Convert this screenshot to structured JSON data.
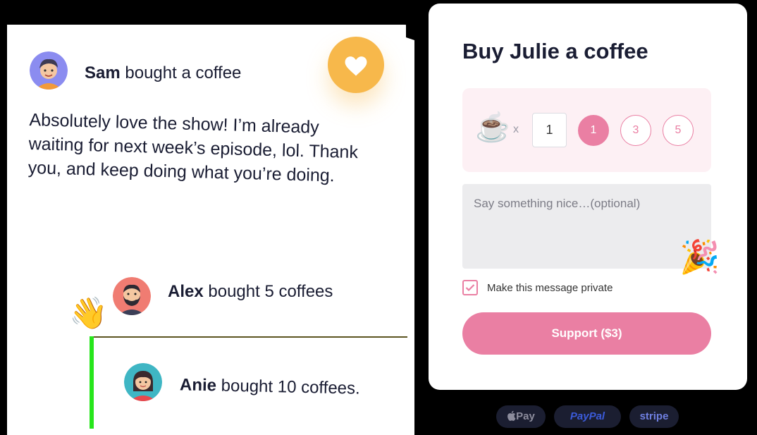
{
  "feed": {
    "first_supporter": {
      "name": "Sam",
      "action": " bought a coffee"
    },
    "message": "Absolutely love the show! I’m already waiting for next week’s episode, lol. Thank you, and keep doing what you’re doing.",
    "supporters": [
      {
        "name": "Alex",
        "action": "  bought 5 coffees"
      },
      {
        "name": "Anie",
        "action": " bought 10 coffees."
      }
    ],
    "heart_icon": "heart-icon",
    "wave_emoji": "👋"
  },
  "support": {
    "title": "Buy Julie a coffee",
    "coffee_emoji": "☕",
    "multiplier": "x",
    "quantity_value": "1",
    "quantity_options": [
      "1",
      "3",
      "5"
    ],
    "selected_option": "1",
    "note_placeholder": "Say something nice…(optional)",
    "party_emoji": "🎉",
    "private_label": "Make this message private",
    "private_checked": true,
    "button_label": "Support ($3)"
  },
  "payments": {
    "apple_pay": "Pay",
    "paypal": "PayPal",
    "stripe": "stripe"
  },
  "colors": {
    "accent_pink": "#ea7fa3",
    "heart_yellow": "#f7b84b",
    "panel_pink": "#fdf0f4",
    "text_dark": "#1a1d33"
  }
}
